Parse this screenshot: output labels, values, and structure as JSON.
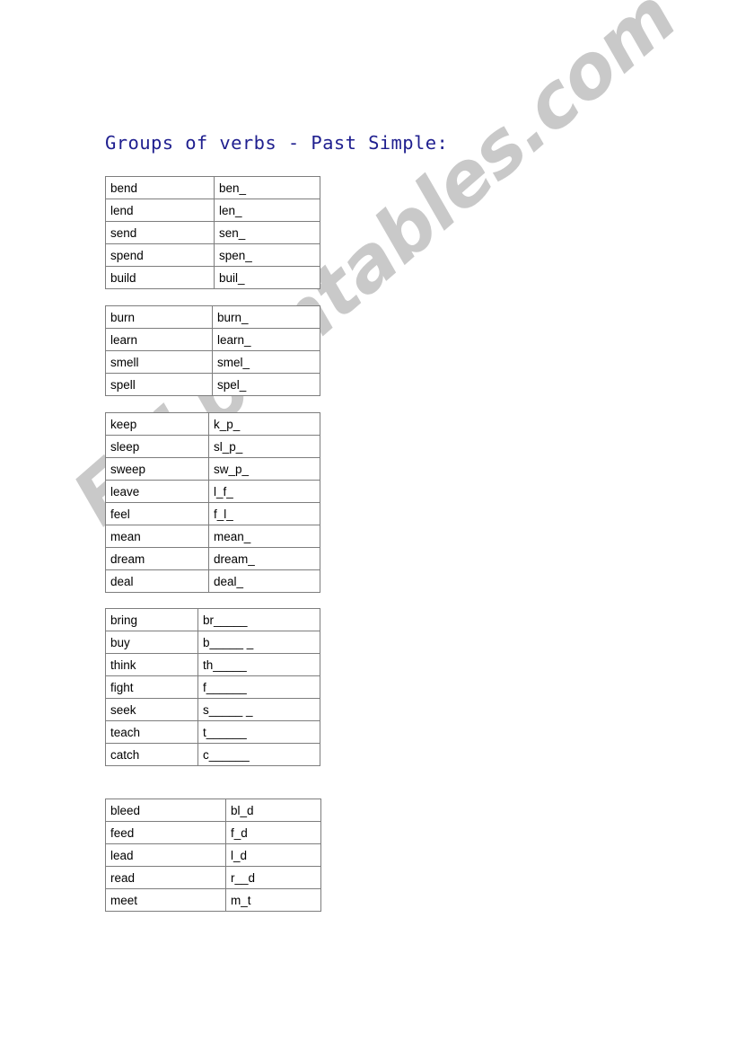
{
  "document": {
    "title": "Groups of verbs - Past Simple:",
    "title_color": "#1f1f8f",
    "background_color": "#ffffff",
    "border_color": "#7d7d7d"
  },
  "watermark": {
    "text": "ESLprintables.com",
    "color": "#c9c9c9",
    "rotation_degrees": -41
  },
  "tables": [
    {
      "id": "table-1",
      "rows": [
        {
          "verb": "bend",
          "past_blank": "ben_"
        },
        {
          "verb": "lend",
          "past_blank": "len_"
        },
        {
          "verb": "send",
          "past_blank": "sen_"
        },
        {
          "verb": "spend",
          "past_blank": "spen_"
        },
        {
          "verb": "build",
          "past_blank": "buil_"
        }
      ]
    },
    {
      "id": "table-2",
      "rows": [
        {
          "verb": "burn",
          "past_blank": "burn_"
        },
        {
          "verb": "learn",
          "past_blank": "learn_"
        },
        {
          "verb": "smell",
          "past_blank": "smel_"
        },
        {
          "verb": "spell",
          "past_blank": "spel_"
        }
      ]
    },
    {
      "id": "table-3",
      "rows": [
        {
          "verb": "keep",
          "past_blank": "k_p_"
        },
        {
          "verb": "sleep",
          "past_blank": "sl_p_"
        },
        {
          "verb": "sweep",
          "past_blank": "sw_p_"
        },
        {
          "verb": "leave",
          "past_blank": "l_f_"
        },
        {
          "verb": "feel",
          "past_blank": "f_l_"
        },
        {
          "verb": "mean",
          "past_blank": "mean_"
        },
        {
          "verb": "dream",
          "past_blank": "dream_"
        },
        {
          "verb": "deal",
          "past_blank": "deal_"
        }
      ]
    },
    {
      "id": "table-4",
      "rows": [
        {
          "verb": "bring",
          "past_blank": "br_____"
        },
        {
          "verb": "buy",
          "past_blank": "b_____ _"
        },
        {
          "verb": "think",
          "past_blank": "th_____"
        },
        {
          "verb": "fight",
          "past_blank": "f______"
        },
        {
          "verb": "seek",
          "past_blank": "s_____ _"
        },
        {
          "verb": "teach",
          "past_blank": "t______"
        },
        {
          "verb": "catch",
          "past_blank": "c______"
        }
      ]
    },
    {
      "id": "table-5",
      "rows": [
        {
          "verb": "bleed",
          "past_blank": "bl_d"
        },
        {
          "verb": "feed",
          "past_blank": "f_d"
        },
        {
          "verb": "lead",
          "past_blank": "l_d"
        },
        {
          "verb": "read",
          "past_blank": "r__d"
        },
        {
          "verb": "meet",
          "past_blank": "m_t"
        }
      ]
    }
  ]
}
